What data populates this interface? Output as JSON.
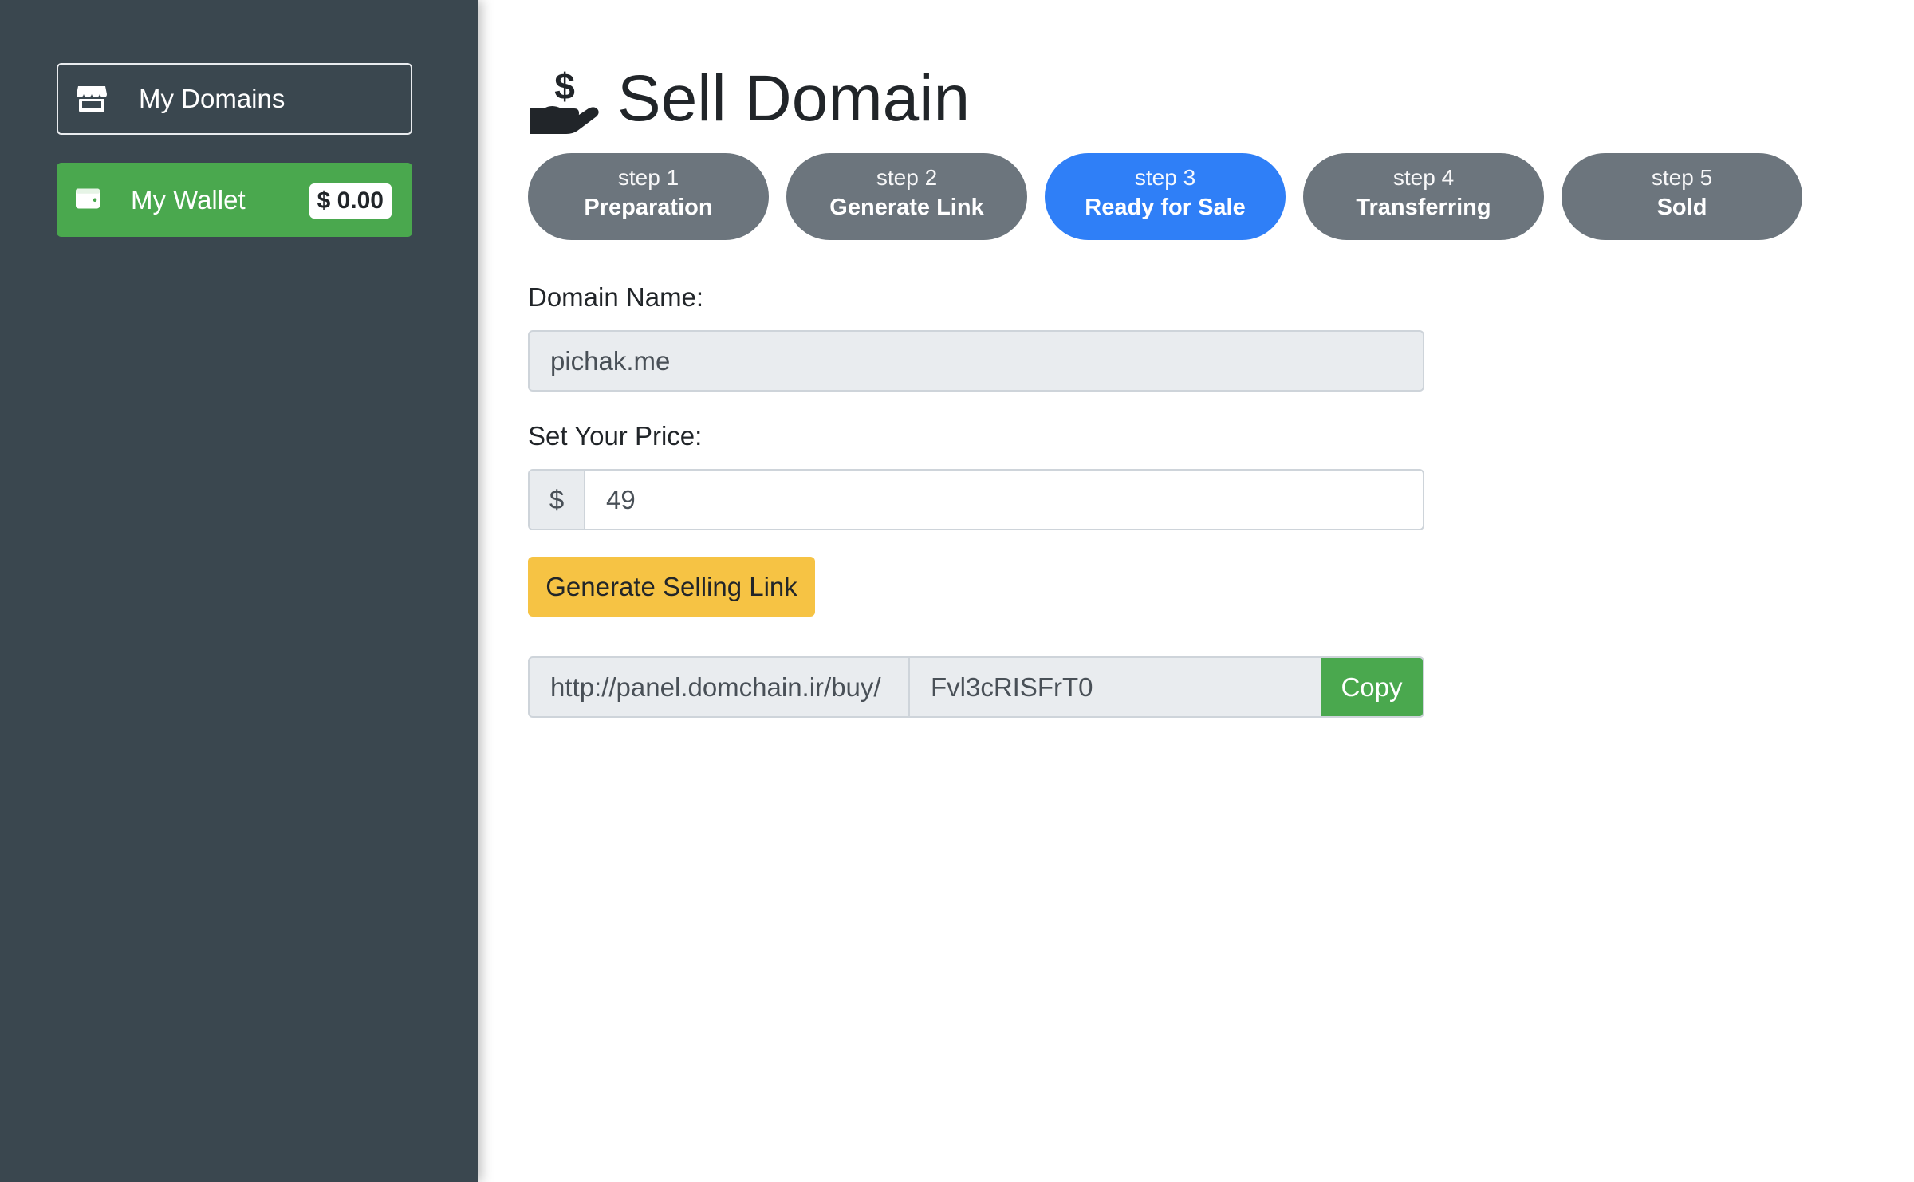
{
  "sidebar": {
    "my_domains_label": "My Domains",
    "my_wallet_label": "My Wallet",
    "wallet_balance": "$ 0.00"
  },
  "header": {
    "title": "Sell Domain"
  },
  "steps": [
    {
      "num": "step 1",
      "name": "Preparation",
      "active": false
    },
    {
      "num": "step 2",
      "name": "Generate Link",
      "active": false
    },
    {
      "num": "step 3",
      "name": "Ready for Sale",
      "active": true
    },
    {
      "num": "step 4",
      "name": "Transferring",
      "active": false
    },
    {
      "num": "step 5",
      "name": "Sold",
      "active": false
    }
  ],
  "form": {
    "domain_label": "Domain Name:",
    "domain_value": "pichak.me",
    "price_label": "Set Your Price:",
    "price_currency": "$",
    "price_value": "49",
    "generate_button": "Generate Selling Link",
    "link_prefix": "http://panel.domchain.ir/buy/",
    "link_code": "Fvl3cRISFrT0",
    "copy_button": "Copy"
  },
  "colors": {
    "sidebar_bg": "#3a474f",
    "wallet_green": "#4aa84e",
    "step_active": "#2f7ff7",
    "step_inactive": "#6c757d",
    "generate_yellow": "#f6c344"
  }
}
